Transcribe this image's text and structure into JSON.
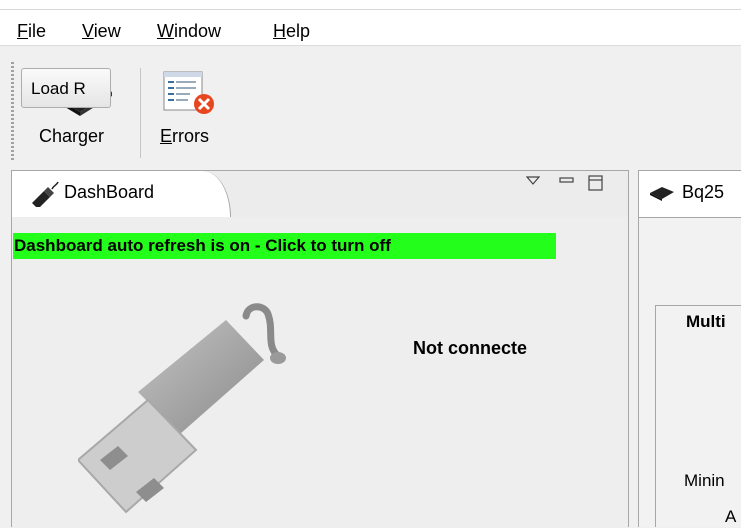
{
  "menu": {
    "items": [
      {
        "mnemonic": "F",
        "rest": "ile"
      },
      {
        "mnemonic": "V",
        "rest": "iew"
      },
      {
        "mnemonic": "W",
        "rest": "indow"
      },
      {
        "mnemonic": "H",
        "rest": "elp"
      }
    ]
  },
  "toolbar": {
    "charger": {
      "label": "Charger",
      "icon": "chip-icon"
    },
    "errors": {
      "mnemonic": "E",
      "rest": "rrors",
      "icon": "errors-icon"
    }
  },
  "dashboard": {
    "tab_title": "DashBoard",
    "refresh_banner": "Dashboard auto refresh is on - Click to turn off",
    "status": "Not connecte",
    "banner_color": "#23ff1a"
  },
  "device_panel": {
    "tab_title": "Bq25",
    "load_button": "Load R",
    "group_title": "Multi",
    "line1": "Minin",
    "line2": "A"
  }
}
